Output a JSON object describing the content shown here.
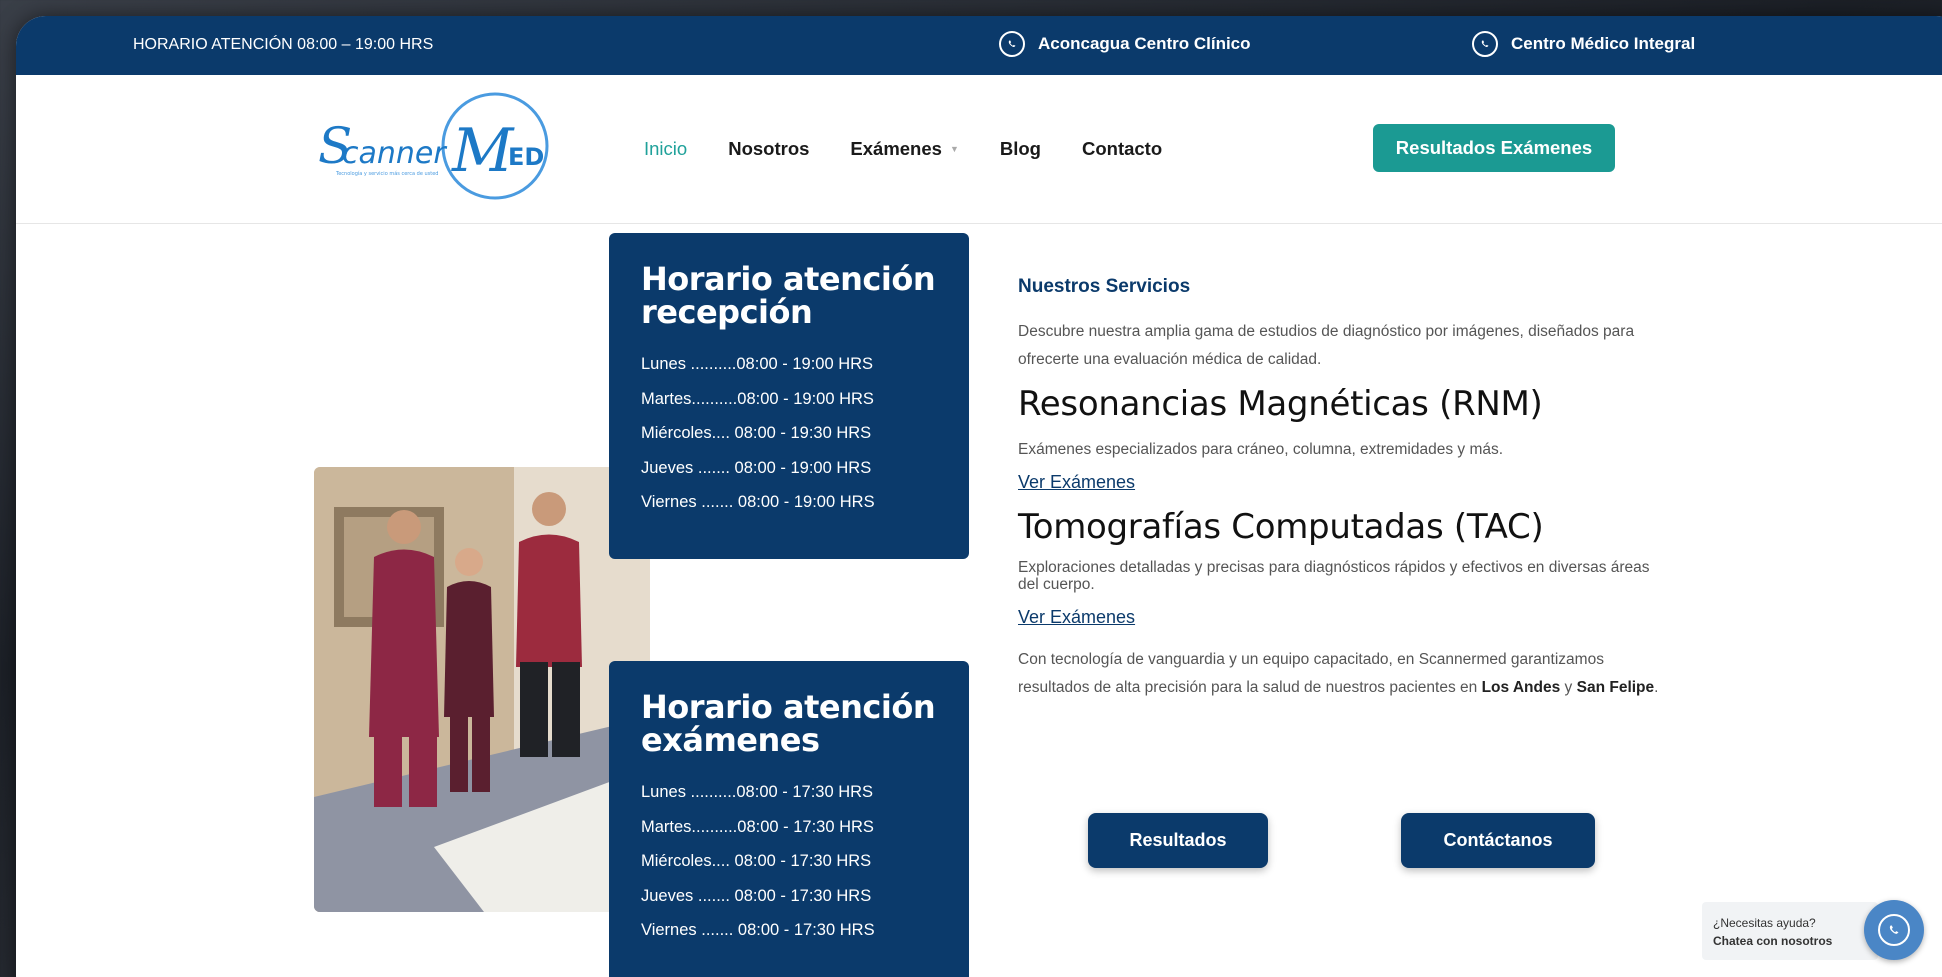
{
  "topbar": {
    "hours": "HORARIO ATENCIÓN 08:00 – 19:00 HRS",
    "contact1": "Aconcagua Centro Clínico",
    "contact2": "Centro Médico Integral"
  },
  "header": {
    "logo_text": "ScannerMed",
    "logo_tagline": "Tecnología y servicio más cerca de usted",
    "nav": [
      "Inicio",
      "Nosotros",
      "Exámenes",
      "Blog",
      "Contacto"
    ],
    "results_button": "Resultados Exámenes"
  },
  "schedule_reception": {
    "title": "Horario atención recepción",
    "rows": [
      "Lunes ..........08:00 - 19:00 HRS",
      "Martes..........08:00 - 19:00 HRS",
      "Miércoles.... 08:00 - 19:30 HRS",
      "Jueves ....... 08:00 - 19:00 HRS",
      "Viernes ....... 08:00 - 19:00 HRS"
    ]
  },
  "schedule_exams": {
    "title": "Horario atención exámenes",
    "rows": [
      "Lunes ..........08:00 - 17:30 HRS",
      "Martes..........08:00 - 17:30 HRS",
      "Miércoles.... 08:00 - 17:30 HRS",
      "Jueves ....... 08:00 - 17:30 HRS",
      "Viernes ....... 08:00 - 17:30 HRS"
    ]
  },
  "services": {
    "label": "Nuestros Servicios",
    "intro": "Descubre nuestra amplia gama de estudios de diagnóstico por imágenes, diseñados para ofrecerte una evaluación médica de calidad.",
    "rnm_title": "Resonancias Magnéticas (RNM)",
    "rnm_desc": "Exámenes especializados para cráneo, columna, extremidades y más.",
    "rnm_link": "Ver Exámenes",
    "tac_title": "Tomografías Computadas (TAC)",
    "tac_desc": "Exploraciones detalladas y precisas para diagnósticos rápidos y efectivos en diversas áreas del cuerpo.",
    "tac_link": "Ver Exámenes",
    "closing_a": "Con tecnología de vanguardia y un equipo capacitado, en Scannermed garantizamos resultados de alta precisión para la salud de nuestros pacientes en ",
    "closing_b": "Los Andes",
    "closing_c": " y ",
    "closing_d": "San Felipe",
    "closing_e": ".",
    "btn_results": "Resultados",
    "btn_contact": "Contáctanos"
  },
  "chat": {
    "line1": "¿Necesitas ayuda?",
    "line2": "Chatea con nosotros"
  },
  "colors": {
    "navy": "#0b3a6b",
    "teal": "#1b9a93",
    "chat_blue": "#4a86c6"
  }
}
